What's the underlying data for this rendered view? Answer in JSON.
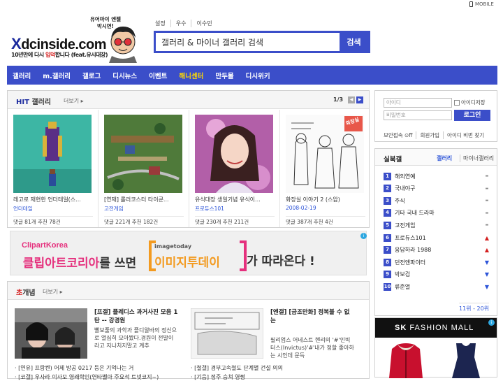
{
  "top": {
    "mobile_label": "MOBILE"
  },
  "logo": {
    "text_mark": "X",
    "text_main": "dcinside.com",
    "sub_pre": "10년만에 다시 ",
    "sub_red": "입덕",
    "sub_post": "합니다 (feat.유시대장)",
    "bubble_line1": "유어마이 엔젤",
    "bubble_line2": "박시연!"
  },
  "quick_links": [
    "설정",
    "우수",
    "이수민"
  ],
  "search": {
    "value": "갤러리 & 마이너 갤러리 검색",
    "button": "검색"
  },
  "nav": [
    {
      "label": "갤러리",
      "highlight": false
    },
    {
      "label": "m.갤러리",
      "highlight": false
    },
    {
      "label": "갤로그",
      "highlight": false
    },
    {
      "label": "디시뉴스",
      "highlight": false
    },
    {
      "label": "이벤트",
      "highlight": false
    },
    {
      "label": "해니센터",
      "highlight": true
    },
    {
      "label": "만두몰",
      "highlight": false
    },
    {
      "label": "디시위키",
      "highlight": false
    }
  ],
  "hit": {
    "title_accent": "HIT",
    "title_rest": " 갤러리",
    "more": "더보기 ▸",
    "page": "1/3",
    "prev": "◀",
    "next": "▶",
    "cards": [
      {
        "title": "레고로 재현한 언더테일(스...",
        "gallery": "언더테일",
        "stats": "댓글 81개   추천 78건"
      },
      {
        "title": "[연재] 롤러코스터 타이쿤...",
        "gallery": "고전게임",
        "stats": "댓글 221개   추천 182건"
      },
      {
        "title": "유식대장 생일기념 유식이...",
        "gallery": "프로듀스101",
        "stats": "댓글 230개   추천 211건"
      },
      {
        "title": "화장실 이야기 2 (스압)",
        "gallery": "2008-02-19",
        "stats": "댓글 387개   추천 4건"
      }
    ],
    "card4_badge": "화장실"
  },
  "ad": {
    "brand": "ClipartKorea",
    "left_pink": "클립아트코리아",
    "left_dark": "를 쓰면",
    "sub": "imagetoday",
    "main": "이미지투데이",
    "right": "가 따라온다 !",
    "info": "i"
  },
  "concept": {
    "title_accent": "초",
    "title_rest": "개념",
    "more": "더보기 ▸",
    "article1_title": "[프갤] 플레디스 과거사진 모음 1탄 -- 강경원",
    "article1_body": "빨보풀의 과학과 플디알바의 정신으로 열심히 모아봤다.경원이 전발이라고 지나치지말고 계추",
    "article2_title": "[엔갤] [금조만화] 정복불 수 없는",
    "article2_body": "필리업스 어네스트 헨리의 '#'인빅터스(Invictus)'#'내가 정할 좋아하는 시인데 문득",
    "bullets_left": [
      "· [연유] 프랑켄) 어제 방공 0217 등은 기억나는 거",
      "· [코갤] 우사라 이사모 영래학인(연타벨아 주요석 트넷코지~)"
    ],
    "bullets_right": [
      "· [철갤] 경부고속철도 단계별 건설 의의",
      "· [기음] 정주 승쳐 영쩡"
    ]
  },
  "login": {
    "id_placeholder": "아이디",
    "pw_placeholder": "비밀번호",
    "save_id": "아이디저장",
    "login_btn": "로그인",
    "links": [
      "보안접속 ⊙ff",
      "회원가입",
      "아이디 비번 찾기"
    ]
  },
  "realtime": {
    "title": "실북갤",
    "tab1": "갤러리",
    "tab2": "마이너갤러리",
    "items": [
      {
        "rank": "1",
        "name": "해외연예",
        "trend": "eq"
      },
      {
        "rank": "2",
        "name": "국내야구",
        "trend": "eq"
      },
      {
        "rank": "3",
        "name": "주식",
        "trend": "eq"
      },
      {
        "rank": "4",
        "name": "기타 국내 드라마",
        "trend": "eq"
      },
      {
        "rank": "5",
        "name": "고전게임",
        "trend": "eq"
      },
      {
        "rank": "6",
        "name": "프로듀스101",
        "trend": "up"
      },
      {
        "rank": "7",
        "name": "응답하라 1988",
        "trend": "up"
      },
      {
        "rank": "8",
        "name": "던전앤파이터",
        "trend": "dn"
      },
      {
        "rank": "9",
        "name": "박보검",
        "trend": "dn"
      },
      {
        "rank": "10",
        "name": "류준열",
        "trend": "dn"
      }
    ],
    "range": "11위 - 20위"
  },
  "mall": {
    "title_bold": "SK",
    "title_rest": " FASHION MALL",
    "info": "i"
  }
}
